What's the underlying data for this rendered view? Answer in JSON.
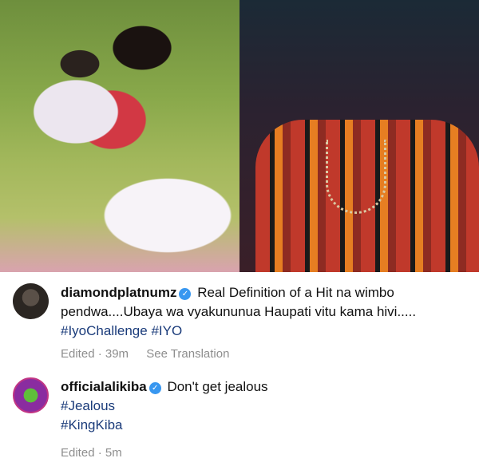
{
  "comments": [
    {
      "username": "diamondplatnumz",
      "text": "Real Definition of a Hit na wimbo pendwa....Ubaya wa vyakununua Haupati vitu kama hivi.....",
      "hashtags": [
        "#IyoChallenge",
        "#IYO"
      ],
      "meta": {
        "edited": "Edited · 39m",
        "translate": "See Translation"
      }
    },
    {
      "username": "officialalikiba",
      "text": "Don't get jealous",
      "hashtags": [
        "#Jealous",
        "#KingKiba"
      ],
      "meta": {
        "edited": "Edited · 5m"
      }
    }
  ],
  "icons": {
    "verified": "verified-badge-icon"
  },
  "colors": {
    "verified": "#3897f0",
    "hashtag": "#1a3b7a",
    "meta": "#8e8e8e"
  }
}
